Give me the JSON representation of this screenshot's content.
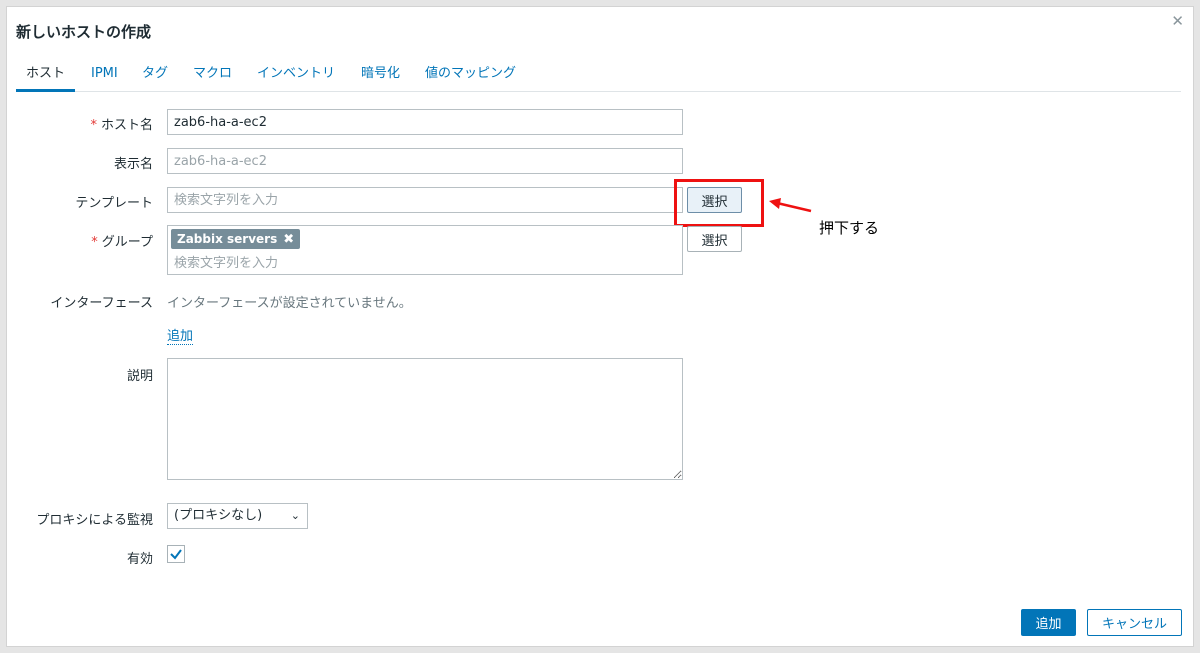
{
  "dialog": {
    "title": "新しいホストの作成",
    "close_icon": "✕"
  },
  "tabs": [
    {
      "label": "ホスト",
      "active": true
    },
    {
      "label": "IPMI"
    },
    {
      "label": "タグ"
    },
    {
      "label": "マクロ"
    },
    {
      "label": "インベントリ"
    },
    {
      "label": "暗号化"
    },
    {
      "label": "値のマッピング"
    }
  ],
  "form": {
    "host_name": {
      "required_mark": "*",
      "label": "ホスト名",
      "value": "zab6-ha-a-ec2"
    },
    "visible_name": {
      "label": "表示名",
      "placeholder": "zab6-ha-a-ec2"
    },
    "templates": {
      "label": "テンプレート",
      "placeholder": "検索文字列を入力",
      "select_label": "選択"
    },
    "groups": {
      "required_mark": "*",
      "label": "グループ",
      "chip": "Zabbix servers",
      "chip_remove": "✖",
      "placeholder": "検索文字列を入力",
      "select_label": "選択"
    },
    "interfaces": {
      "label": "インターフェース",
      "empty_text": "インターフェースが設定されていません。",
      "add_link": "追加"
    },
    "description": {
      "label": "説明",
      "value": ""
    },
    "proxy": {
      "label": "プロキシによる監視",
      "selected": "(プロキシなし)"
    },
    "enabled": {
      "label": "有効",
      "checked": true
    }
  },
  "annotation": {
    "text": "押下する",
    "color": "#ee1111"
  },
  "footer": {
    "add_label": "追加",
    "cancel_label": "キャンセル"
  },
  "colors": {
    "accent": "#0275b8",
    "required": "#e33734",
    "chip_bg": "#768d99"
  }
}
